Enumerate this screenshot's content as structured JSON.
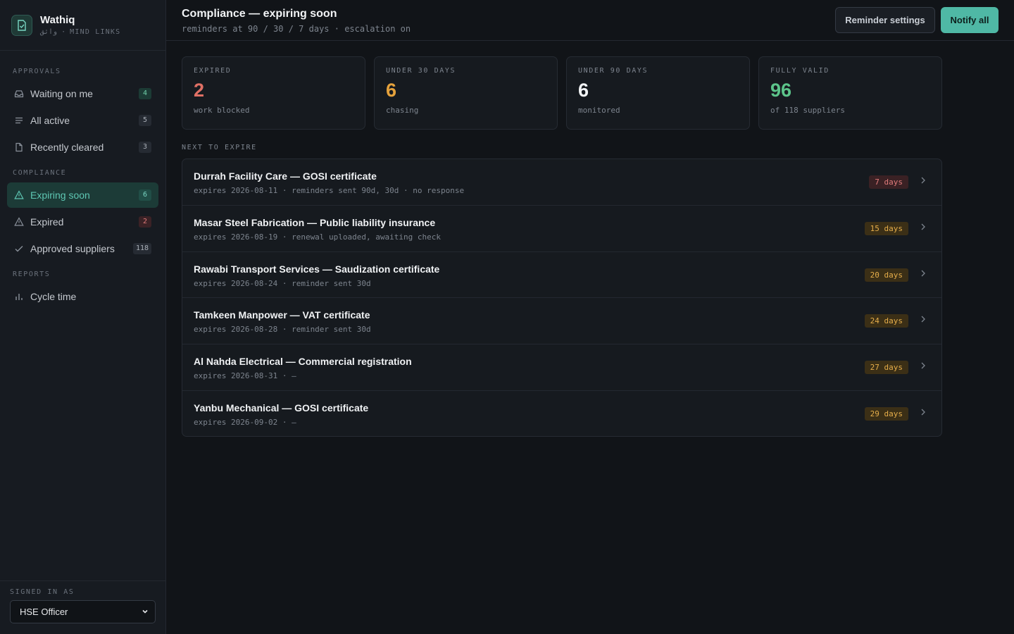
{
  "app": {
    "name": "Wathiq",
    "subtitle": "واثق · MIND LINKS"
  },
  "sidebar": {
    "sections": [
      {
        "label": "APPROVALS"
      },
      {
        "label": "COMPLIANCE"
      },
      {
        "label": "REPORTS"
      }
    ],
    "items": [
      {
        "label": "Waiting on me",
        "count": "4",
        "icon": "inbox-icon"
      },
      {
        "label": "All active",
        "count": "5",
        "icon": "list-icon"
      },
      {
        "label": "Recently cleared",
        "count": "3",
        "icon": "document-icon"
      },
      {
        "label": "Expiring soon",
        "count": "6",
        "icon": "warning-icon",
        "active": true
      },
      {
        "label": "Expired",
        "count": "2",
        "icon": "warning-icon"
      },
      {
        "label": "Approved suppliers",
        "count": "118",
        "icon": "check-icon"
      },
      {
        "label": "Cycle time",
        "count": "",
        "icon": "bar-chart-icon"
      }
    ],
    "footer": {
      "label": "SIGNED IN AS",
      "role": "HSE Officer"
    }
  },
  "header": {
    "title": "Compliance — expiring soon",
    "subtitle": "reminders at 90 / 30 / 7 days · escalation on",
    "reminder_button": "Reminder settings",
    "notify_button": "Notify all"
  },
  "stats": [
    {
      "label": "EXPIRED",
      "value": "2",
      "note": "work blocked",
      "color": "#e07065"
    },
    {
      "label": "UNDER 30 DAYS",
      "value": "6",
      "note": "chasing",
      "color": "#e5a23c"
    },
    {
      "label": "UNDER 90 DAYS",
      "value": "6",
      "note": "monitored",
      "color": "#f2f4f6"
    },
    {
      "label": "FULLY VALID",
      "value": "96",
      "note": "of 118 suppliers",
      "color": "#5cc48a"
    }
  ],
  "list": {
    "heading": "NEXT TO EXPIRE",
    "rows": [
      {
        "title": "Durrah Facility Care — GOSI certificate",
        "sub": "expires 2026-08-11 · reminders sent 90d, 30d · no response",
        "badge": "7 days",
        "severity": "red"
      },
      {
        "title": "Masar Steel Fabrication — Public liability insurance",
        "sub": "expires 2026-08-19 · renewal uploaded, awaiting check",
        "badge": "15 days",
        "severity": "amber"
      },
      {
        "title": "Rawabi Transport Services — Saudization certificate",
        "sub": "expires 2026-08-24 · reminder sent 30d",
        "badge": "20 days",
        "severity": "amber"
      },
      {
        "title": "Tamkeen Manpower — VAT certificate",
        "sub": "expires 2026-08-28 · reminder sent 30d",
        "badge": "24 days",
        "severity": "amber"
      },
      {
        "title": "Al Nahda Electrical — Commercial registration",
        "sub": "expires 2026-08-31 · —",
        "badge": "27 days",
        "severity": "amber"
      },
      {
        "title": "Yanbu Mechanical — GOSI certificate",
        "sub": "expires 2026-09-02 · —",
        "badge": "29 days",
        "severity": "amber"
      }
    ]
  }
}
